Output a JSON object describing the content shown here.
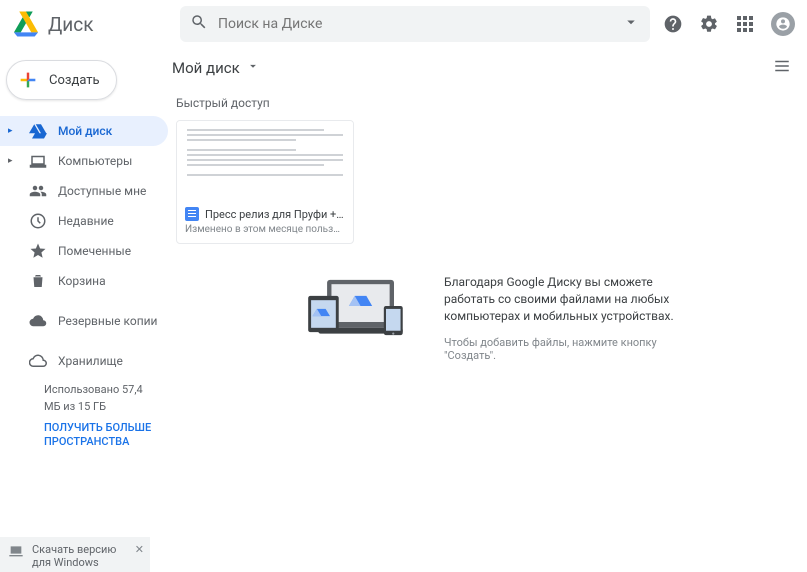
{
  "app_name": "Диск",
  "search": {
    "placeholder": "Поиск на Диске"
  },
  "create_button": "Создать",
  "nav": {
    "my_drive": "Мой диск",
    "computers": "Компьютеры",
    "shared": "Доступные мне",
    "recent": "Недавние",
    "starred": "Помеченные",
    "trash": "Корзина",
    "backups": "Резервные копии",
    "storage": "Хранилище"
  },
  "storage": {
    "usage": "Использовано 57,4 МБ из 15 ГБ",
    "link": "ПОЛУЧИТЬ БОЛЬШЕ ПРОСТРАНСТВА"
  },
  "downloader": {
    "label": "Скачать версию для Windows"
  },
  "breadcrumb": "Мой диск",
  "quick_access_label": "Быстрый доступ",
  "card": {
    "title": "Пресс релиз для Пруфи + легенда ...",
    "subtitle": "Изменено в этом месяце пользователем ..."
  },
  "empty": {
    "title": "Благодаря Google Диску вы сможете работать со своими файлами на любых компьютерах и мобильных устройствах.",
    "subtitle": "Чтобы добавить файлы, нажмите кнопку \"Создать\"."
  }
}
